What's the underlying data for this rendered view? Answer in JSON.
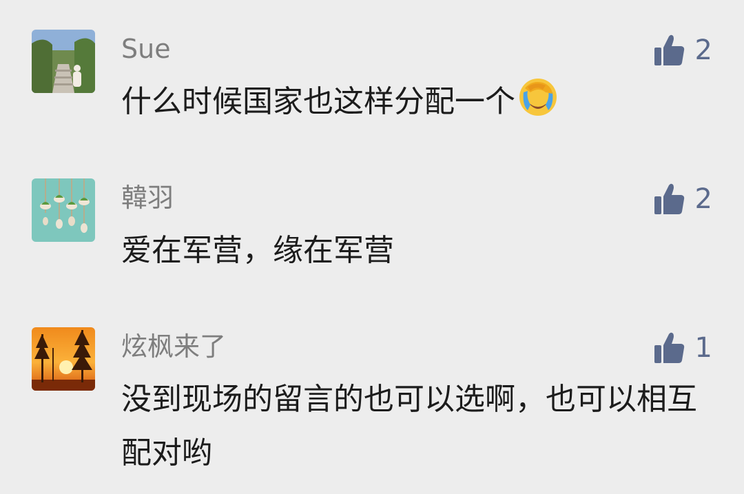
{
  "comments": [
    {
      "author": "Sue",
      "text": "什么时候国家也这样分配一个",
      "emoji": "face-palm-crying-emoji",
      "likes": "2",
      "avatar": "mountain-stairs-photo"
    },
    {
      "author": "韓羽",
      "text": "爱在军营，缘在军营",
      "likes": "2",
      "avatar": "hanging-plants-photo"
    },
    {
      "author": "炫枫来了",
      "text": "没到现场的留言的也可以选啊，也可以相互配对哟",
      "likes": "1",
      "avatar": "sunset-trees-photo"
    }
  ],
  "like_icon": "thumbs-up-icon",
  "colors": {
    "background": "#ededed",
    "name": "#7e7e7e",
    "text": "#1c1c1c",
    "like": "#5b6a8c"
  }
}
